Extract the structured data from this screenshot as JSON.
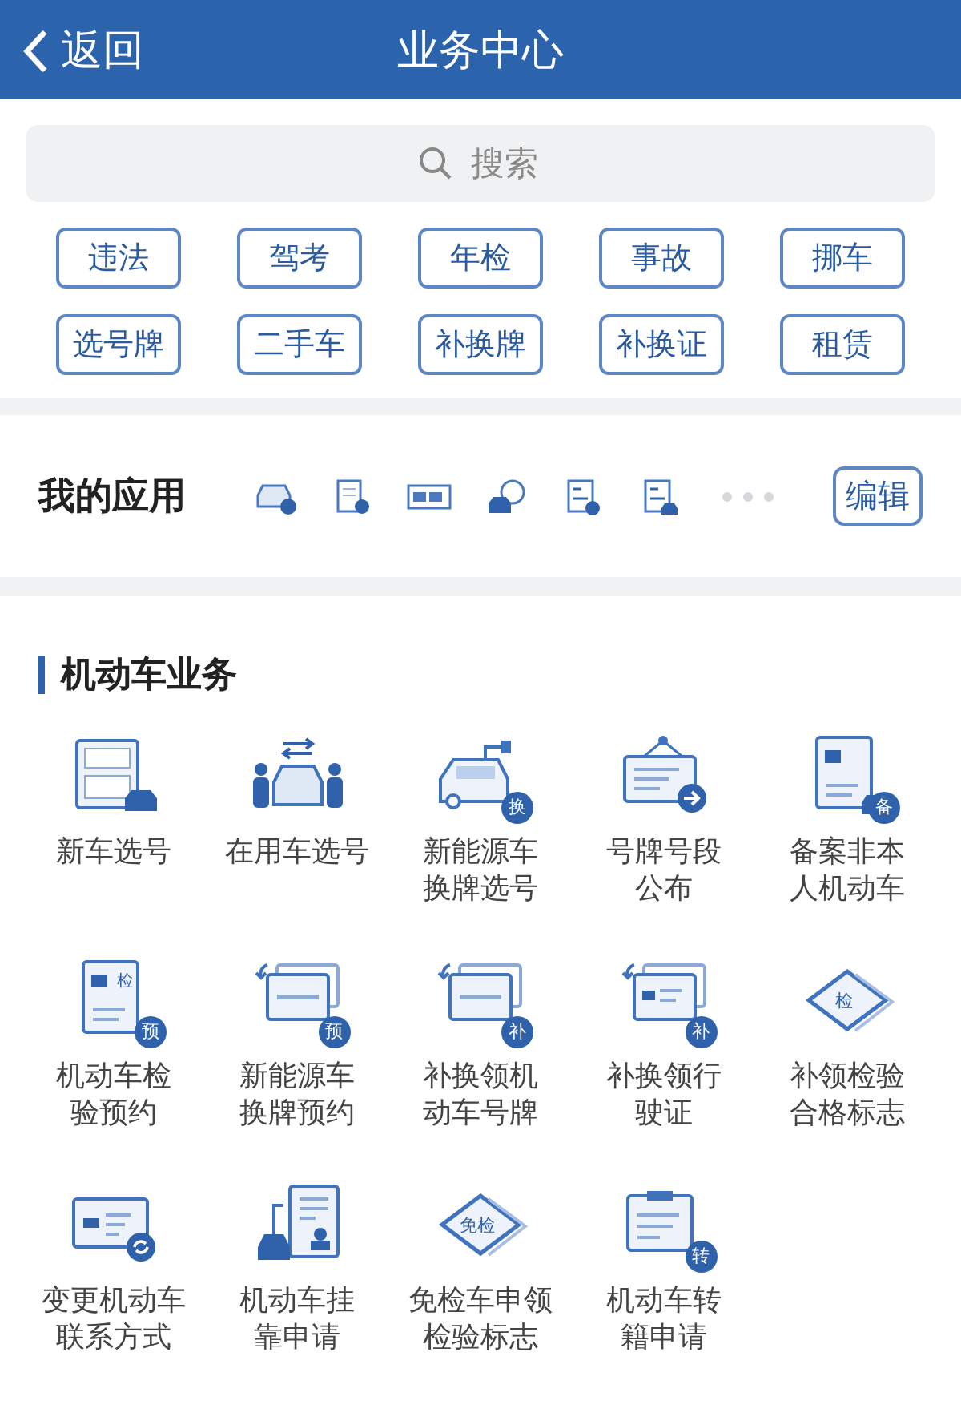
{
  "header": {
    "back_label": "返回",
    "title": "业务中心"
  },
  "search": {
    "placeholder": "搜索"
  },
  "tags": [
    "违法",
    "驾考",
    "年检",
    "事故",
    "挪车",
    "选号牌",
    "二手车",
    "补换牌",
    "补换证",
    "租赁"
  ],
  "my_apps": {
    "title": "我的应用",
    "icons": [
      {
        "kind": "car"
      },
      {
        "kind": "scroll"
      },
      {
        "kind": "plate"
      },
      {
        "kind": "car-bubble"
      },
      {
        "kind": "doc"
      },
      {
        "kind": "doc-car"
      }
    ],
    "edit_label": "编辑"
  },
  "section": {
    "title": "机动车业务",
    "items": [
      {
        "label": "新车选号",
        "kind": "plate-form"
      },
      {
        "label": "在用车选号",
        "kind": "handover"
      },
      {
        "label": "新能源车换牌选号",
        "kind": "ev-car",
        "badge": "换"
      },
      {
        "label": "号牌号段公布",
        "kind": "notice"
      },
      {
        "label": "备案非本人机动车",
        "kind": "record-doc",
        "badge": "备"
      },
      {
        "label": "机动车检验预约",
        "kind": "doc-badge",
        "badge": "预",
        "tag": "检"
      },
      {
        "label": "新能源车换牌预约",
        "kind": "plate-swap",
        "badge": "预"
      },
      {
        "label": "补换领机动车号牌",
        "kind": "plate-swap",
        "badge": "补"
      },
      {
        "label": "补换领行驶证",
        "kind": "card-swap",
        "badge": "补"
      },
      {
        "label": "补领检验合格标志",
        "kind": "diamond",
        "tag": "检"
      },
      {
        "label": "变更机动车联系方式",
        "kind": "card-refresh"
      },
      {
        "label": "机动车挂靠申请",
        "kind": "doc-car"
      },
      {
        "label": "免检车申领检验标志",
        "kind": "diamond",
        "tag": "免检"
      },
      {
        "label": "机动车转籍申请",
        "kind": "clipboard",
        "badge": "转"
      }
    ]
  }
}
